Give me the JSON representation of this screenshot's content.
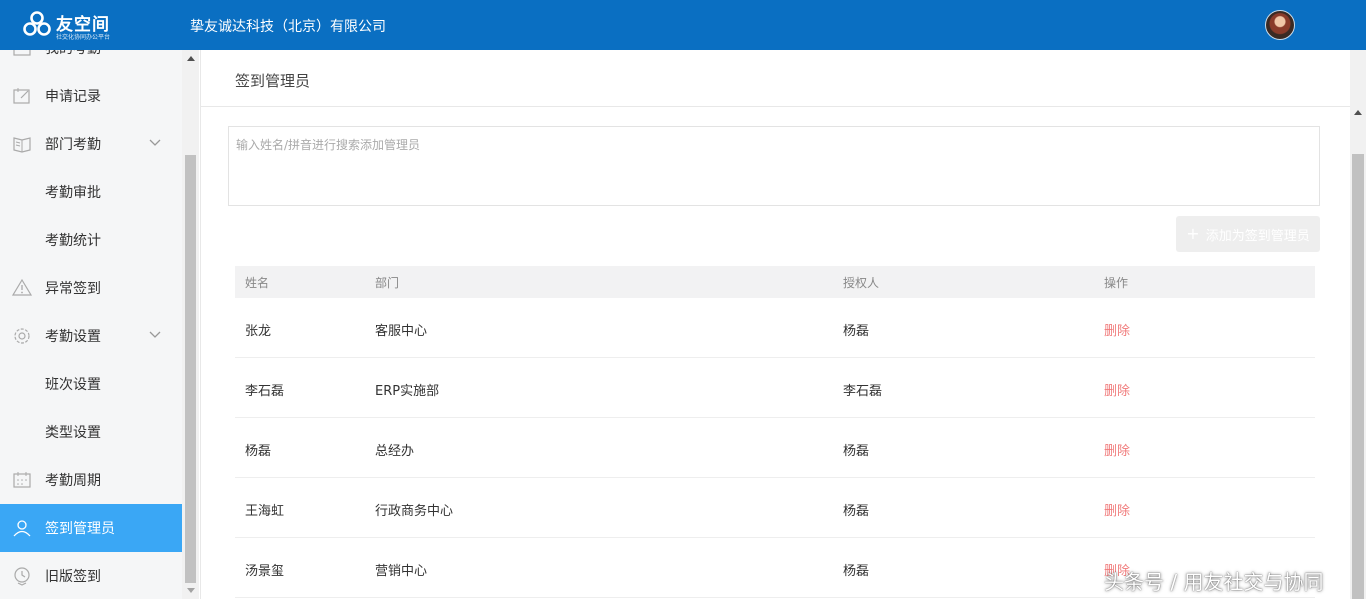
{
  "header": {
    "logo_name": "友空间",
    "logo_tagline": "社交化协同办公平台",
    "company": "挚友诚达科技（北京）有限公司"
  },
  "sidebar": {
    "items": [
      {
        "label": "我的考勤",
        "icon": "calendar-icon"
      },
      {
        "label": "申请记录",
        "icon": "edit-note-icon"
      },
      {
        "label": "部门考勤",
        "icon": "book-icon"
      },
      {
        "label": "考勤审批"
      },
      {
        "label": "考勤统计"
      },
      {
        "label": "异常签到",
        "icon": "warning-icon"
      },
      {
        "label": "考勤设置",
        "icon": "gear-icon"
      },
      {
        "label": "班次设置"
      },
      {
        "label": "类型设置"
      },
      {
        "label": "考勤周期",
        "icon": "calendar-grid-icon"
      },
      {
        "label": "签到管理员",
        "icon": "user-icon",
        "active": true
      },
      {
        "label": "旧版签到",
        "icon": "location-clock-icon"
      }
    ]
  },
  "main": {
    "title": "签到管理员",
    "search_placeholder": "输入姓名/拼音进行搜索添加管理员",
    "add_button": "添加为签到管理员",
    "table": {
      "headers": [
        "姓名",
        "部门",
        "授权人",
        "操作"
      ],
      "rows": [
        {
          "name": "张龙",
          "dept": "客服中心",
          "grantor": "杨磊",
          "action": "删除"
        },
        {
          "name": "李石磊",
          "dept": "ERP实施部",
          "grantor": "李石磊",
          "action": "删除"
        },
        {
          "name": "杨磊",
          "dept": "总经办",
          "grantor": "杨磊",
          "action": "删除"
        },
        {
          "name": "王海虹",
          "dept": "行政商务中心",
          "grantor": "杨磊",
          "action": "删除"
        },
        {
          "name": "汤景玺",
          "dept": "营销中心",
          "grantor": "杨磊",
          "action": "删除"
        }
      ]
    }
  },
  "watermark": "头条号 / 用友社交与协同",
  "colors": {
    "header_bg": "#0a6fc2",
    "sidebar_active": "#3aa7f5",
    "delete_link": "#f07a7a"
  }
}
